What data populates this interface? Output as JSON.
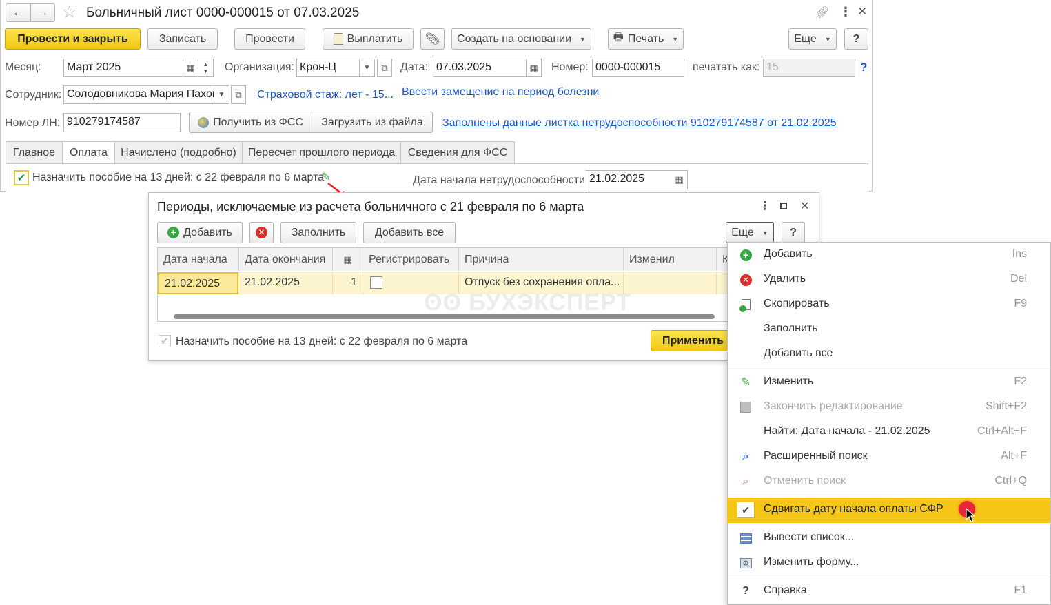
{
  "main_window": {
    "title": "Больничный лист 0000-000015 от 07.03.2025",
    "toolbar": {
      "post_close": "Провести и закрыть",
      "save": "Записать",
      "post": "Провести",
      "pay": "Выплатить",
      "create_based": "Создать на основании",
      "print": "Печать",
      "more": "Еще",
      "help": "?"
    },
    "fields": {
      "month_label": "Месяц:",
      "month_value": "Март 2025",
      "org_label": "Организация:",
      "org_value": "Крон-Ц",
      "date_label": "Дата:",
      "date_value": "07.03.2025",
      "number_label": "Номер:",
      "number_value": "0000-000015",
      "print_as_label": "печатать как:",
      "print_as_value": "15",
      "employee_label": "Сотрудник:",
      "employee_value": "Солодовникова Мария Пахом",
      "insurance_link": "Страховой стаж: лет - 15...",
      "replacement_link": "Ввести замещение на период болезни",
      "ln_label": "Номер ЛН:",
      "ln_value": "910279174587",
      "get_fss": "Получить из ФСС",
      "load_file": "Загрузить из файла",
      "filled_link": "Заполнены данные листка нетрудоспособности 910279174587 от 21.02.2025"
    },
    "tabs": [
      "Главное",
      "Оплата",
      "Начислено (подробно)",
      "Пересчет прошлого периода",
      "Сведения для ФСС"
    ],
    "assign_benefit": "Назначить пособие на 13 дней: с 22 февраля по 6 марта",
    "incapacity_start_label": "Дата начала нетрудоспособности:",
    "incapacity_start_value": "21.02.2025",
    "help_q": "?"
  },
  "dialog": {
    "title": "Периоды, исключаемые из расчета больничного с 21 февраля по 6 марта",
    "toolbar": {
      "add": "Добавить",
      "fill": "Заполнить",
      "add_all": "Добавить все",
      "more": "Еще",
      "help": "?"
    },
    "columns": [
      "Дата начала",
      "Дата окончания",
      "",
      "Регистрировать",
      "Причина",
      "Изменил",
      "К"
    ],
    "rows": [
      {
        "start": "21.02.2025",
        "end": "21.02.2025",
        "days": "1",
        "register": false,
        "reason": "Отпуск без сохранения опла..."
      }
    ],
    "assign_benefit": "Назначить пособие на 13 дней: с 22 февраля по 6 марта",
    "apply": "Применить",
    "watermark": "БУХЭКСПЕРТ"
  },
  "menu": {
    "items": [
      {
        "label": "Добавить",
        "key": "Ins",
        "icon": "add-icon"
      },
      {
        "label": "Удалить",
        "key": "Del",
        "icon": "delete-icon"
      },
      {
        "label": "Скопировать",
        "key": "F9",
        "icon": "copy-icon"
      },
      {
        "label": "Заполнить",
        "key": "",
        "icon": ""
      },
      {
        "label": "Добавить все",
        "key": "",
        "icon": ""
      },
      {
        "label": "Изменить",
        "key": "F2",
        "icon": "pencil-icon"
      },
      {
        "label": "Закончить редактирование",
        "key": "Shift+F2",
        "icon": "end-edit-icon"
      },
      {
        "label": "Найти: Дата начала - 21.02.2025",
        "key": "Ctrl+Alt+F",
        "icon": ""
      },
      {
        "label": "Расширенный поиск",
        "key": "Alt+F",
        "icon": "search-icon"
      },
      {
        "label": "Отменить поиск",
        "key": "Ctrl+Q",
        "icon": "cancel-search-icon"
      },
      {
        "label": "Сдвигать дату начала оплаты СФР",
        "key": "",
        "icon": "checkmark-icon"
      },
      {
        "label": "Вывести список...",
        "key": "",
        "icon": "output-list-icon"
      },
      {
        "label": "Изменить форму...",
        "key": "",
        "icon": "change-form-icon"
      },
      {
        "label": "Справка",
        "key": "F1",
        "icon": "help-icon"
      }
    ]
  },
  "colors": {
    "accent_yellow": "#f5d21c",
    "highlight_row": "#fbf4cf",
    "link_blue": "#1a56c6",
    "menu_highlight": "#f5c518"
  }
}
